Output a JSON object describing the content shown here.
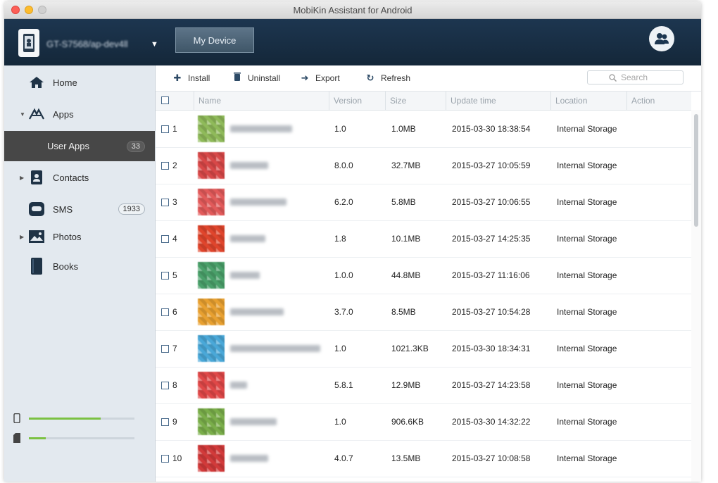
{
  "window": {
    "title": "MobiKin Assistant for Android"
  },
  "header": {
    "device_name": "GT-S7568/ap-dev4ll",
    "my_device_label": "My Device"
  },
  "sidebar": {
    "items": [
      {
        "label": "Home",
        "icon": "home-icon"
      },
      {
        "label": "Apps",
        "icon": "apps-icon"
      },
      {
        "label": "User Apps",
        "count": "33"
      },
      {
        "label": "Contacts",
        "icon": "contacts-icon"
      },
      {
        "label": "SMS",
        "icon": "sms-icon",
        "count": "1933"
      },
      {
        "label": "Photos",
        "icon": "photos-icon"
      },
      {
        "label": "Books",
        "icon": "books-icon"
      }
    ],
    "storage": {
      "phone_fraction": 0.68,
      "sdcard_fraction": 0.16
    }
  },
  "toolbar": {
    "install": "Install",
    "uninstall": "Uninstall",
    "export": "Export",
    "refresh": "Refresh",
    "search_placeholder": "Search"
  },
  "table": {
    "columns": [
      "Name",
      "Version",
      "Size",
      "Update time",
      "Location",
      "Action"
    ],
    "rows": [
      {
        "num": "1",
        "version": "1.0",
        "size": "1.0MB",
        "time": "2015-03-30 18:38:54",
        "location": "Internal Storage",
        "icon_color": "#8fba5a"
      },
      {
        "num": "2",
        "version": "8.0.0",
        "size": "32.7MB",
        "time": "2015-03-27 10:05:59",
        "location": "Internal Storage",
        "icon_color": "#d84848"
      },
      {
        "num": "3",
        "version": "6.2.0",
        "size": "5.8MB",
        "time": "2015-03-27 10:06:55",
        "location": "Internal Storage",
        "icon_color": "#e25a5a"
      },
      {
        "num": "4",
        "version": "1.8",
        "size": "10.1MB",
        "time": "2015-03-27 14:25:35",
        "location": "Internal Storage",
        "icon_color": "#e0452c"
      },
      {
        "num": "5",
        "version": "1.0.0",
        "size": "44.8MB",
        "time": "2015-03-27 11:16:06",
        "location": "Internal Storage",
        "icon_color": "#4aa06a"
      },
      {
        "num": "6",
        "version": "3.7.0",
        "size": "8.5MB",
        "time": "2015-03-27 10:54:28",
        "location": "Internal Storage",
        "icon_color": "#e8a030"
      },
      {
        "num": "7",
        "version": "1.0",
        "size": "1021.3KB",
        "time": "2015-03-30 18:34:31",
        "location": "Internal Storage",
        "icon_color": "#4aa8d8"
      },
      {
        "num": "8",
        "version": "5.8.1",
        "size": "12.9MB",
        "time": "2015-03-27 14:23:58",
        "location": "Internal Storage",
        "icon_color": "#e04848"
      },
      {
        "num": "9",
        "version": "1.0",
        "size": "906.6KB",
        "time": "2015-03-30 14:32:22",
        "location": "Internal Storage",
        "icon_color": "#7aae4a"
      },
      {
        "num": "10",
        "version": "4.0.7",
        "size": "13.5MB",
        "time": "2015-03-27 10:08:58",
        "location": "Internal Storage",
        "icon_color": "#d23a3a"
      }
    ]
  }
}
